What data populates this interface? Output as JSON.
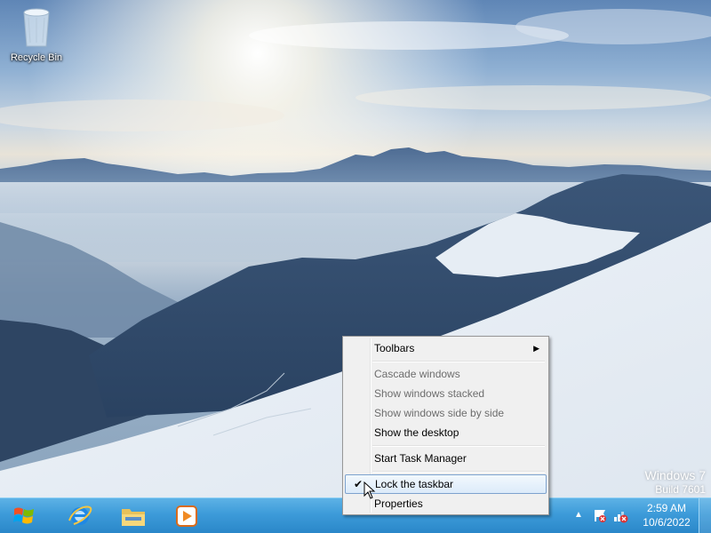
{
  "desktop": {
    "icons": [
      {
        "label": "Recycle Bin",
        "icon": "recycle-bin-icon"
      }
    ],
    "watermark": {
      "os_name": "Windows 7",
      "build": "Build 7601"
    }
  },
  "context_menu": {
    "items": [
      {
        "label": "Toolbars",
        "enabled": true,
        "submenu": true
      },
      {
        "separator": true
      },
      {
        "label": "Cascade windows",
        "enabled": false
      },
      {
        "label": "Show windows stacked",
        "enabled": false
      },
      {
        "label": "Show windows side by side",
        "enabled": false
      },
      {
        "label": "Show the desktop",
        "enabled": true
      },
      {
        "separator": true
      },
      {
        "label": "Start Task Manager",
        "enabled": true
      },
      {
        "separator": true
      },
      {
        "label": "Lock the taskbar",
        "enabled": true,
        "checked": true,
        "hovered": true
      },
      {
        "label": "Properties",
        "enabled": true
      }
    ]
  },
  "taskbar": {
    "start_icon": "windows-logo-icon",
    "pinned": [
      {
        "icon": "internet-explorer-icon"
      },
      {
        "icon": "file-explorer-icon"
      },
      {
        "icon": "media-player-icon"
      }
    ],
    "tray": {
      "icons": [
        "show-hidden-icons-arrow",
        "action-center-flag-icon",
        "network-disconnected-icon"
      ],
      "time": "2:59 AM",
      "date": "10/6/2022"
    }
  },
  "colors": {
    "taskbar": "#3d9bd9",
    "menu_background": "#f0f0f0",
    "menu_highlight_border": "#7da2ce"
  }
}
